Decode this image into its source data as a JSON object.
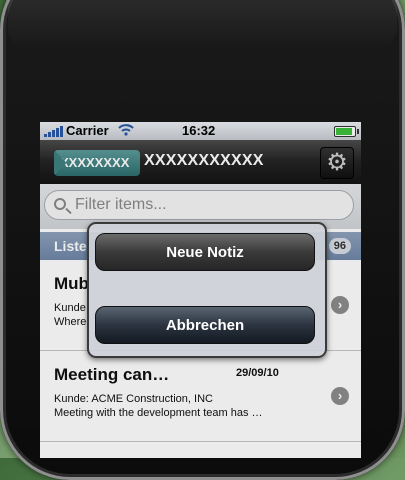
{
  "status_bar": {
    "carrier": "Carrier",
    "time": "16:32"
  },
  "nav": {
    "back_label": "XXXXXXXX",
    "title": "XXXXXXXXXXX"
  },
  "search": {
    "placeholder": "Filter items..."
  },
  "section": {
    "title": "Liste",
    "count": "96"
  },
  "rows": [
    {
      "title": "Mub",
      "date": "",
      "line1": "Kunde",
      "line2": "Where"
    },
    {
      "title": "Meeting can…",
      "date": "29/09/10",
      "line1": "Kunde: ACME Construction, INC",
      "line2": "Meeting with the development team has …"
    }
  ],
  "popover": {
    "new_label": "Neue Notiz",
    "cancel_label": "Abbrechen"
  },
  "icons": {
    "gear": "gear-icon",
    "search": "search-icon",
    "chevron": "chevron-right-icon",
    "wifi": "wifi-icon",
    "battery": "battery-icon"
  },
  "colors": {
    "battery_fill": "#3fc23f",
    "back_button": "#3f8080",
    "section_header": "#7a90ad"
  }
}
